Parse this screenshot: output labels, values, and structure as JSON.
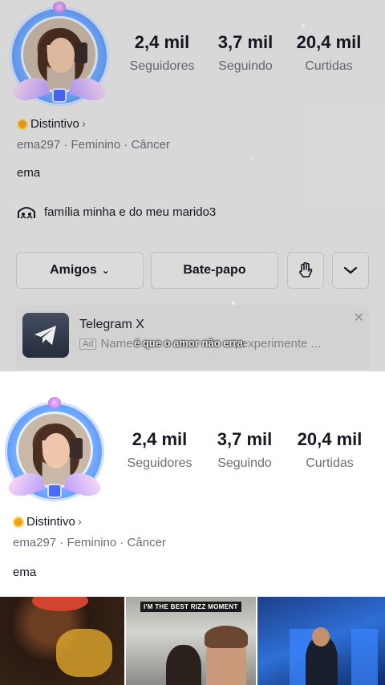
{
  "top": {
    "stats": [
      {
        "value": "2,4 mil",
        "label": "Seguidores"
      },
      {
        "value": "3,7 mil",
        "label": "Seguindo"
      },
      {
        "value": "20,4 mil",
        "label": "Curtidas"
      }
    ],
    "badge": "Distintivo",
    "meta": "ema297 · Feminino · Câncer",
    "bio": "ema",
    "link_text": "família minha e do meu marido3",
    "buttons": {
      "friends": "Amigos",
      "chat": "Bate-papo"
    },
    "ad": {
      "title": "Telegram X",
      "tag": "Ad",
      "subtitle": "Name",
      "subtitle_tail": ", experimente ..."
    },
    "caption": "é que o amor não erra"
  },
  "bottom": {
    "stats": [
      {
        "value": "2,4 mil",
        "label": "Seguidores"
      },
      {
        "value": "3,7 mil",
        "label": "Seguindo"
      },
      {
        "value": "20,4 mil",
        "label": "Curtidas"
      }
    ],
    "badge": "Distintivo",
    "meta": "ema297 · Feminino · Câncer",
    "bio": "ema",
    "thumb_banner": "I'M THE BEST RIZZ MOMENT"
  },
  "icons": {
    "badge": "badge-coin-icon",
    "chevron": "chevron-right-icon",
    "link": "group-house-icon",
    "dropdown": "chevron-down-icon",
    "wave": "hand-wave-icon",
    "telegram": "telegram-plane-icon",
    "close": "close-icon"
  }
}
